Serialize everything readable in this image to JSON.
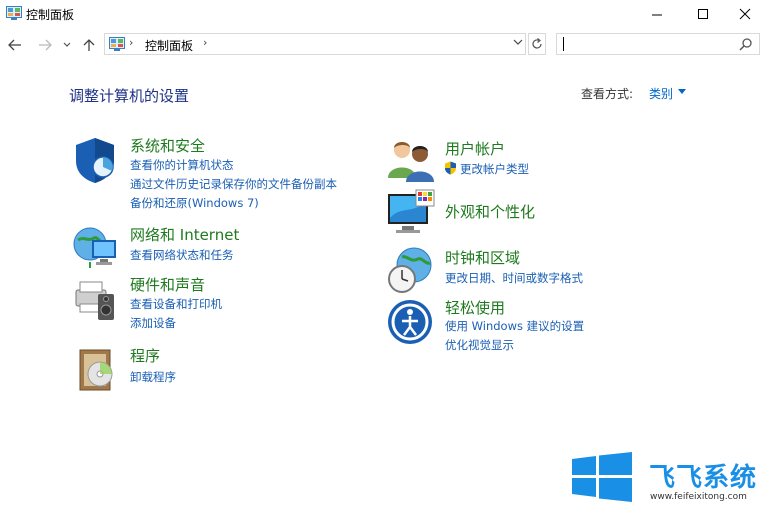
{
  "window": {
    "title": "控制面板"
  },
  "address": {
    "crumb": "控制面板",
    "search_value": ""
  },
  "page": {
    "title": "调整计算机的设置",
    "view_by_label": "查看方式:",
    "view_by_value": "类别"
  },
  "categories": [
    {
      "title": "系统和安全",
      "links": [
        "查看你的计算机状态",
        "通过文件历史记录保存你的文件备份副本",
        "备份和还原(Windows 7)"
      ]
    },
    {
      "title": "网络和 Internet",
      "links": [
        "查看网络状态和任务"
      ]
    },
    {
      "title": "硬件和声音",
      "links": [
        "查看设备和打印机",
        "添加设备"
      ]
    },
    {
      "title": "程序",
      "links": [
        "卸载程序"
      ]
    },
    {
      "title": "用户帐户",
      "links": [
        "更改帐户类型"
      ]
    },
    {
      "title": "外观和个性化",
      "links": []
    },
    {
      "title": "时钟和区域",
      "links": [
        "更改日期、时间或数字格式"
      ]
    },
    {
      "title": "轻松使用",
      "links": [
        "使用 Windows 建议的设置",
        "优化视觉显示"
      ]
    }
  ],
  "watermark": {
    "brand": "飞飞系统",
    "url": "www.feifeixitong.com"
  },
  "colors": {
    "accent": "#1e3287",
    "link": "#1a5fb4",
    "category": "#1e7a1e",
    "logo": "#1a8fe6"
  }
}
